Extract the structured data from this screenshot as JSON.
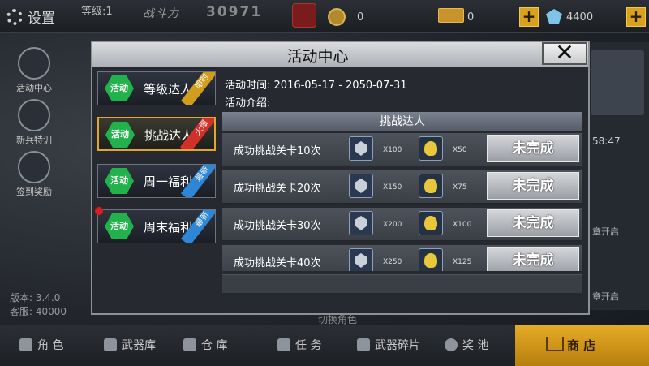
{
  "topbar": {
    "settings_label": "设置",
    "level_label": "等级:1",
    "power_label": "战斗力",
    "power_value": "30971",
    "coin_value": "0",
    "gold_value": "0",
    "gem_value": "4400"
  },
  "left_menu": [
    {
      "label": "活动中心"
    },
    {
      "label": "新兵特训"
    },
    {
      "label": "签到奖励"
    }
  ],
  "footer_info": {
    "version": "版本: 3.4.0",
    "service": "客服: 40000",
    "switch_hint": "切换角色"
  },
  "right_panel": {
    "time": "58:47",
    "open_1": "章开启",
    "open_2": "章开启"
  },
  "bottom_nav": [
    {
      "label": "角 色"
    },
    {
      "label": "武器库"
    },
    {
      "label": "仓 库"
    },
    {
      "label": "任 务"
    },
    {
      "label": "武器碎片"
    },
    {
      "label": "奖 池"
    },
    {
      "label": "商 店"
    }
  ],
  "modal": {
    "title": "活动中心",
    "close_symbol": "✕",
    "activity_icon_text": "活动",
    "tabs": [
      {
        "label": "等级达人",
        "badge": "限时"
      },
      {
        "label": "挑战达人",
        "badge": "火爆"
      },
      {
        "label": "周一福利",
        "badge": "最新"
      },
      {
        "label": "周末福利",
        "badge": "最新"
      }
    ],
    "activity_time_label": "活动时间:",
    "activity_time_value": "2016-05-17 - 2050-07-31",
    "activity_intro_label": "活动介绍:",
    "section_title": "挑战达人",
    "tasks": [
      {
        "label": "成功挑战关卡10次",
        "reward1_qty": "X100",
        "reward2_qty": "X50",
        "status": "未完成"
      },
      {
        "label": "成功挑战关卡20次",
        "reward1_qty": "X150",
        "reward2_qty": "X75",
        "status": "未完成"
      },
      {
        "label": "成功挑战关卡30次",
        "reward1_qty": "X200",
        "reward2_qty": "X100",
        "status": "未完成"
      },
      {
        "label": "成功挑战关卡40次",
        "reward1_qty": "X250",
        "reward2_qty": "X125",
        "status": "未完成"
      }
    ]
  }
}
